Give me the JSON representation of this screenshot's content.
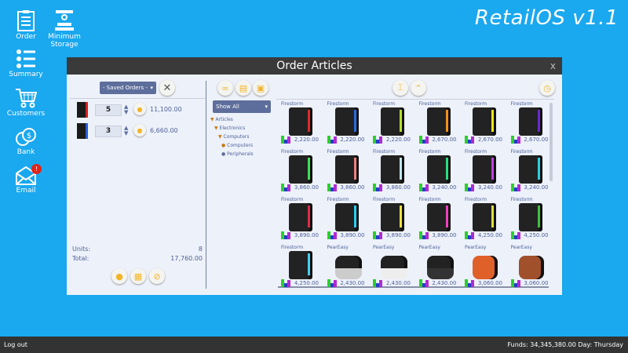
{
  "brand": "RetailOS v1.1",
  "desktop": [
    {
      "label": "Order",
      "icon": "clipboard-icon"
    },
    {
      "label": "Minimum Storage",
      "icon": "crane-icon"
    },
    {
      "label": "Summary",
      "icon": "list-icon"
    },
    {
      "label": "Customers",
      "icon": "cart-icon"
    },
    {
      "label": "Bank",
      "icon": "coins-icon"
    },
    {
      "label": "Email",
      "icon": "envelope-icon",
      "badge": "!"
    }
  ],
  "dialog": {
    "title": "Order Articles",
    "close": "x",
    "saved_orders": "- Saved Orders -",
    "order_lines": [
      {
        "qty": "5",
        "total": "11,100.00",
        "accent": "#d82020"
      },
      {
        "qty": "3",
        "total": "6,660.00",
        "accent": "#2a5bd8"
      }
    ],
    "units_label": "Units:",
    "units": "8",
    "total_label": "Total:",
    "total": "17,760.00",
    "filter": "Show All",
    "tree": [
      "Articles",
      "Electronics",
      "Computers",
      "Computers",
      "Peripherals"
    ],
    "products": [
      {
        "brand": "Firestorm",
        "price": "2,220.00",
        "accent": "#e02a2a"
      },
      {
        "brand": "Firestorm",
        "price": "2,220.00",
        "accent": "#2a6ae0"
      },
      {
        "brand": "Firestorm",
        "price": "2,220.00",
        "accent": "#b5e02a"
      },
      {
        "brand": "Firestorm",
        "price": "2,670.00",
        "accent": "#f0901a"
      },
      {
        "brand": "Firestorm",
        "price": "2,670.00",
        "accent": "#f0e61a"
      },
      {
        "brand": "Firestorm",
        "price": "2,670.00",
        "accent": "#6a2ad0"
      },
      {
        "brand": "Firestorm",
        "price": "3,860.00",
        "accent": "#3ae05a"
      },
      {
        "brand": "Firestorm",
        "price": "3,860.00",
        "accent": "#f08080"
      },
      {
        "brand": "Firestorm",
        "price": "3,860.00",
        "accent": "#bfe6f0"
      },
      {
        "brand": "Firestorm",
        "price": "3,240.00",
        "accent": "#2ae080"
      },
      {
        "brand": "Firestorm",
        "price": "3,240.00",
        "accent": "#c040e0"
      },
      {
        "brand": "Firestorm",
        "price": "3,240.00",
        "accent": "#2ad0e0"
      },
      {
        "brand": "Firestorm",
        "price": "3,890.00",
        "accent": "#e02a4a"
      },
      {
        "brand": "Firestorm",
        "price": "3,890.00",
        "accent": "#2ad0f0"
      },
      {
        "brand": "Firestorm",
        "price": "3,890.00",
        "accent": "#f0e040"
      },
      {
        "brand": "Firestorm",
        "price": "3,890.00",
        "accent": "#f040c0"
      },
      {
        "brand": "Firestorm",
        "price": "4,250.00",
        "accent": "#e0e040"
      },
      {
        "brand": "Firestorm",
        "price": "4,250.00",
        "accent": "#40c040"
      },
      {
        "brand": "Firestorm",
        "price": "4,250.00",
        "accent": "#40d0f0"
      },
      {
        "brand": "PearEasy",
        "price": "2,430.00",
        "accent": "#cccccc"
      },
      {
        "brand": "PearEasy",
        "price": "2,430.00",
        "accent": "#eeeeee"
      },
      {
        "brand": "PearEasy",
        "price": "2,430.00",
        "accent": "#333333"
      },
      {
        "brand": "PearEasy",
        "price": "3,060.00",
        "accent": "#e0602a"
      },
      {
        "brand": "PearEasy",
        "price": "3,060.00",
        "accent": "#a0502a"
      }
    ]
  },
  "taskbar": {
    "logout": "Log out",
    "funds": "Funds: 34,345,380.00  Day: Thursday"
  }
}
